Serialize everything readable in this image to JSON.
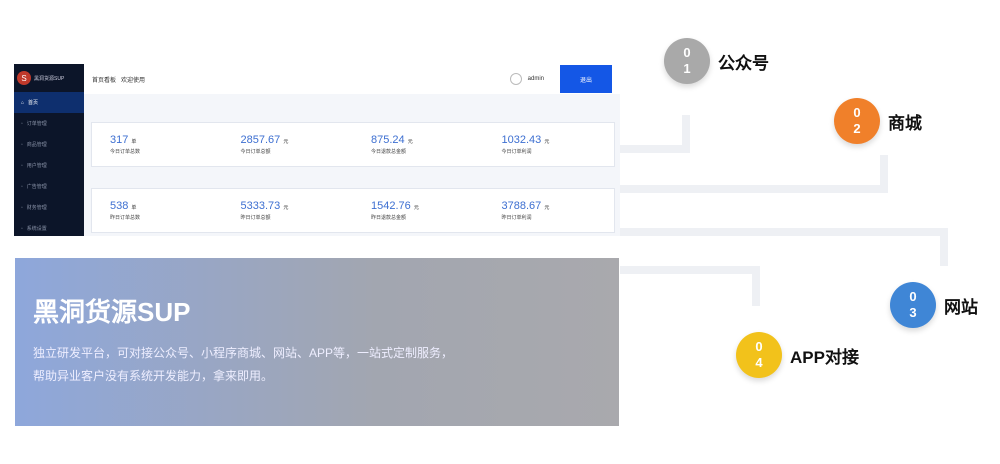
{
  "app": {
    "logo_text": "黑洞货源SUP",
    "breadcrumb": [
      "首页看板",
      "欢迎使用"
    ],
    "user": "admin",
    "logout": "退出"
  },
  "sidebar": [
    "首页",
    "订单管理",
    "商品管理",
    "用户管理",
    "广告管理",
    "财务管理",
    "系统设置"
  ],
  "row1": [
    {
      "v": "317",
      "u": "单",
      "l": "今日订单总数"
    },
    {
      "v": "2857.67",
      "u": "元",
      "l": "今日订单总额"
    },
    {
      "v": "875.24",
      "u": "元",
      "l": "今日退款总金额"
    },
    {
      "v": "1032.43",
      "u": "元",
      "l": "今日订单利润"
    }
  ],
  "row2": [
    {
      "v": "538",
      "u": "单",
      "l": "昨日订单总数"
    },
    {
      "v": "5333.73",
      "u": "元",
      "l": "昨日订单总额"
    },
    {
      "v": "1542.76",
      "u": "元",
      "l": "昨日退款总金额"
    },
    {
      "v": "3788.67",
      "u": "元",
      "l": "昨日订单利润"
    }
  ],
  "banner": {
    "title": "黑洞货源SUP",
    "desc": "独立研发平台，可对接公众号、小程序商城、网站、APP等，一站式定制服务，帮助异业客户没有系统开发能力，拿来即用。"
  },
  "nodes": [
    {
      "n1": "0",
      "n2": "1",
      "label": "公众号",
      "color": "#a9a9a9"
    },
    {
      "n1": "0",
      "n2": "2",
      "label": "商城",
      "color": "#f0802a"
    },
    {
      "n1": "0",
      "n2": "3",
      "label": "网站",
      "color": "#3f86d6"
    },
    {
      "n1": "0",
      "n2": "4",
      "label": "APP对接",
      "color": "#f2c21b"
    }
  ]
}
